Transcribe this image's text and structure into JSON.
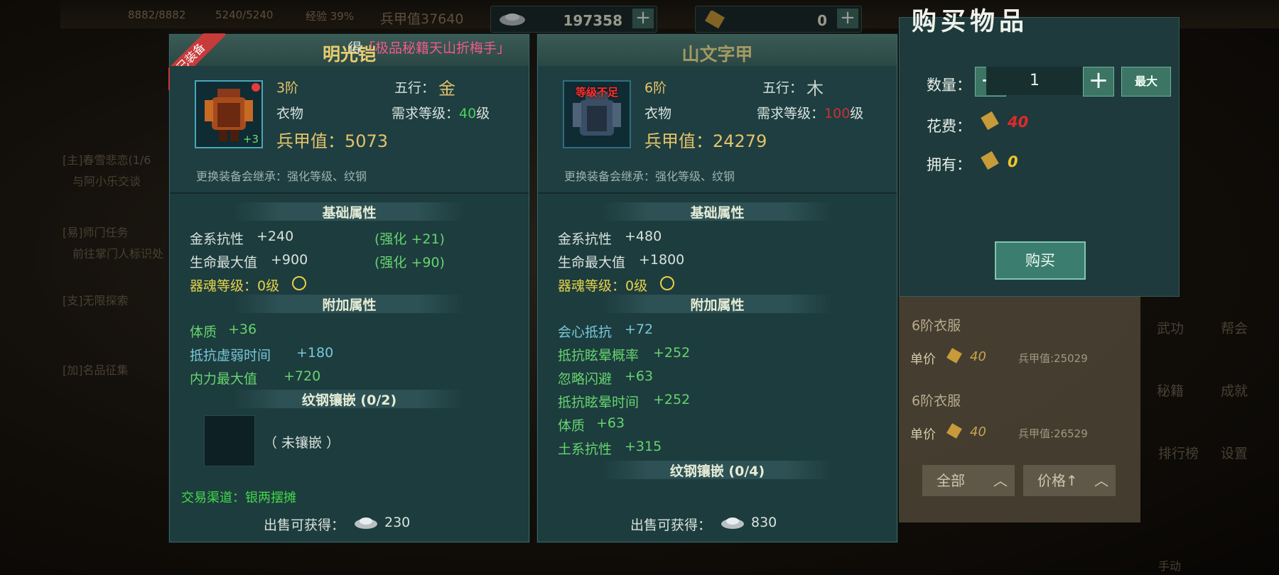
{
  "topbar": {
    "hp": "8882/8882",
    "mp": "5240/5240",
    "exp": "经验 39%",
    "bingjia": "兵甲值37640",
    "silver": "197358",
    "gold": "0"
  },
  "left_quests": [
    "[主]春雪悲恋(1/6",
    "与阿小乐交谈",
    "[易]师门任务",
    "前往掌门人标识处",
    "[支]无限探索",
    "[加]名品征集"
  ],
  "right_menu": [
    "武功",
    "帮会",
    "秘籍",
    "成就",
    "排行榜",
    "设置",
    "手动"
  ],
  "equipped": {
    "badge": "已装备",
    "name": "明光铠",
    "tip_prefix": "得",
    "tip_highlight": "「极品秘籍天山折梅手」",
    "icon_plus": "+3",
    "tier": "3阶",
    "wuxing_label": "五行：",
    "wuxing_glyph": "金",
    "type": "衣物",
    "req_label": "需求等级：",
    "req_level": "40",
    "req_unit": "级",
    "armor_label": "兵甲值：",
    "armor_value": "5073",
    "inherit": "更换装备会继承：强化等级、纹钢",
    "base_title": "基础属性",
    "base_attrs": [
      {
        "name": "金系抗性",
        "value": "+240",
        "bonus": "(强化 +21)"
      },
      {
        "name": "生命最大值",
        "value": "+900",
        "bonus": "(强化 +90)"
      }
    ],
    "soul": "器魂等级：0级",
    "extra_title": "附加属性",
    "extra_attrs": [
      {
        "name": "体质",
        "value": "+36",
        "color": "green"
      },
      {
        "name": "抵抗虚弱时间",
        "value": "+180",
        "color": "cyan"
      },
      {
        "name": "内力最大值",
        "value": "+720",
        "color": "green"
      }
    ],
    "inlay_title": "纹钢镶嵌 (0/2)",
    "inlay_empty": "（ 未镶嵌 ）",
    "trade": "交易渠道：银两摆摊",
    "sell_label": "出售可获得：",
    "sell_value": "230"
  },
  "candidate": {
    "name": "山文字甲",
    "level_warn": "等级不足",
    "tier": "6阶",
    "wuxing_label": "五行：",
    "wuxing_glyph": "木",
    "type": "衣物",
    "req_label": "需求等级：",
    "req_level": "100",
    "req_unit": "级",
    "armor_label": "兵甲值：",
    "armor_value": "24279",
    "inherit": "更换装备会继承：强化等级、纹钢",
    "base_title": "基础属性",
    "base_attrs": [
      {
        "name": "金系抗性",
        "value": "+480"
      },
      {
        "name": "生命最大值",
        "value": "+1800"
      }
    ],
    "soul": "器魂等级：0级",
    "extra_title": "附加属性",
    "extra_attrs": [
      {
        "name": "会心抵抗",
        "value": "+72",
        "color": "cyan"
      },
      {
        "name": "抵抗眩晕概率",
        "value": "+252",
        "color": "green"
      },
      {
        "name": "忽略闪避",
        "value": "+63",
        "color": "green"
      },
      {
        "name": "抵抗眩晕时间",
        "value": "+252",
        "color": "green"
      },
      {
        "name": "体质",
        "value": "+63",
        "color": "green"
      },
      {
        "name": "土系抗性",
        "value": "+315",
        "color": "green"
      }
    ],
    "inlay_title": "纹钢镶嵌 (0/4)",
    "sell_label": "出售可获得：",
    "sell_value": "830"
  },
  "buy": {
    "title": "购买物品",
    "qty_label": "数量：",
    "minus": "−",
    "qty_value": "1",
    "plus": "+",
    "max_label": "最大",
    "cost_label": "花费：",
    "cost_value": "40",
    "own_label": "拥有：",
    "own_value": "0",
    "buy_button": "购买",
    "colors": {
      "cost": "#e02a2a",
      "own": "#f0c42a"
    }
  },
  "shop": {
    "items": [
      {
        "name": "6阶衣服",
        "price_label": "单价",
        "price": "40",
        "armor": "兵甲值:25029"
      },
      {
        "name": "6阶衣服",
        "price_label": "单价",
        "price": "40",
        "armor": "兵甲值:26529"
      }
    ],
    "filter_all": "全部",
    "filter_price": "价格↑"
  }
}
